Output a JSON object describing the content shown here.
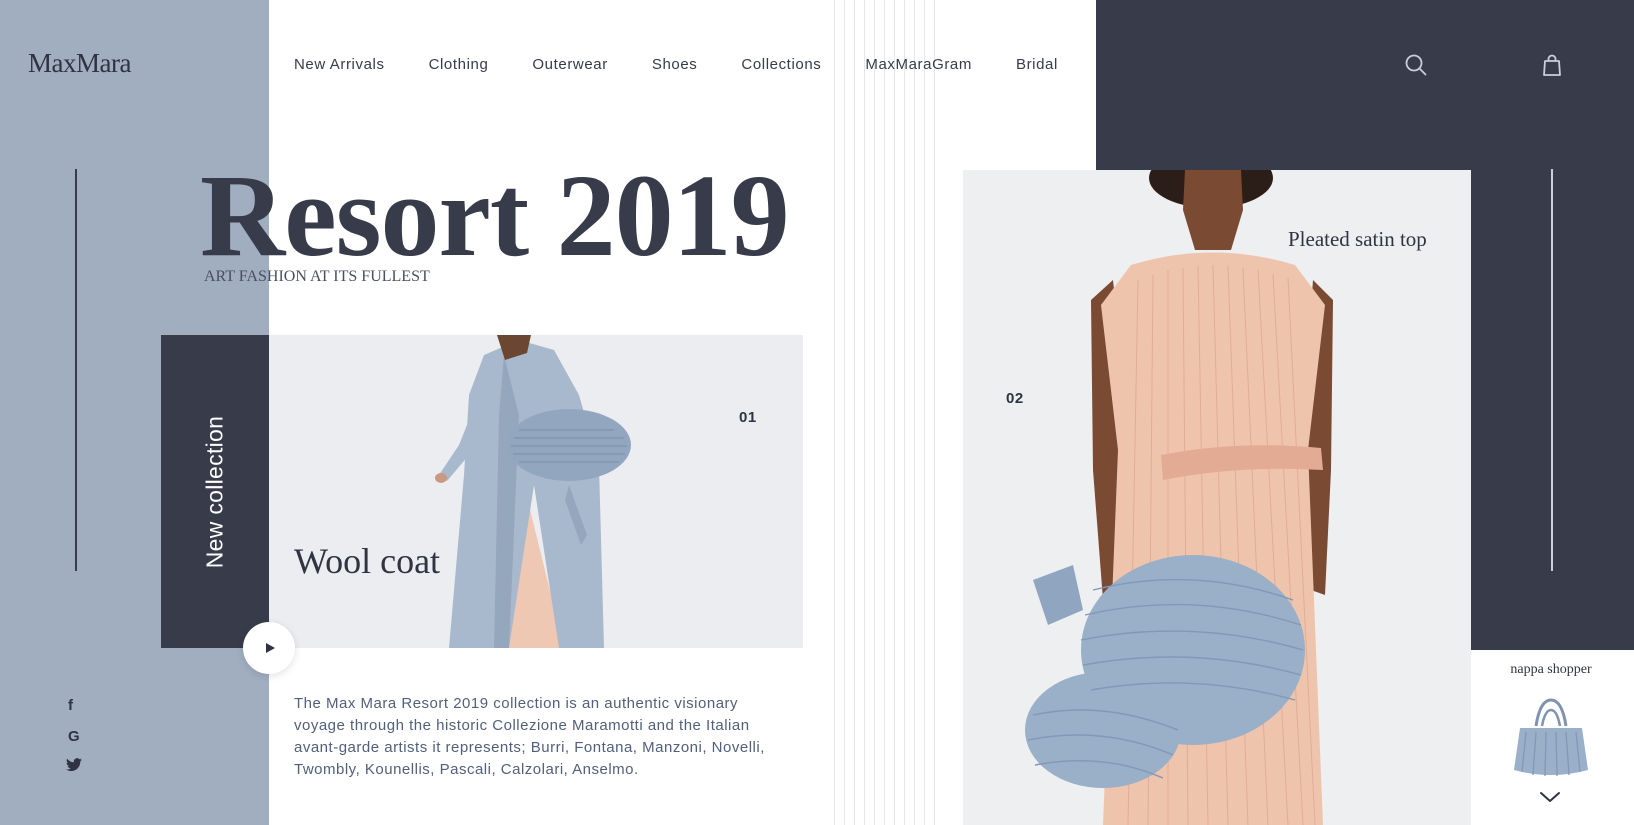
{
  "brand": {
    "logo_text": "MaxMara"
  },
  "nav": {
    "items": [
      {
        "label": "New Arrivals"
      },
      {
        "label": "Clothing"
      },
      {
        "label": "Outerwear"
      },
      {
        "label": "Shoes"
      },
      {
        "label": "Collections"
      },
      {
        "label": "MaxMaraGram"
      },
      {
        "label": "Bridal"
      }
    ]
  },
  "header_icons": {
    "search": "search-icon",
    "bag": "shopping-bag-icon"
  },
  "hero": {
    "title": "Resort 2019",
    "subtitle": "ART FASHION AT ITS FULLEST"
  },
  "collection": {
    "label": "New collection"
  },
  "card1": {
    "number": "01",
    "title": "Wool coat"
  },
  "card2": {
    "number": "02",
    "title": "Pleated satin top"
  },
  "description": "The Max Mara Resort 2019 collection is an authentic visionary voyage through the historic Collezione Maramotti and the Italian avant-garde artists it represents; Burri, Fontana, Manzoni, Novelli, Twombly, Kounellis, Pascali, Calzolari, Anselmo.",
  "social": {
    "facebook": "f",
    "google": "G",
    "twitter": "twitter-icon"
  },
  "shopper": {
    "label": "nappa shopper"
  },
  "colors": {
    "slate_blue": "#a0aec0",
    "dark_navy": "#383b49",
    "coat_blue": "#a9b9cd",
    "dress_peach": "#efc4ad",
    "skin": "#7a4a32"
  }
}
